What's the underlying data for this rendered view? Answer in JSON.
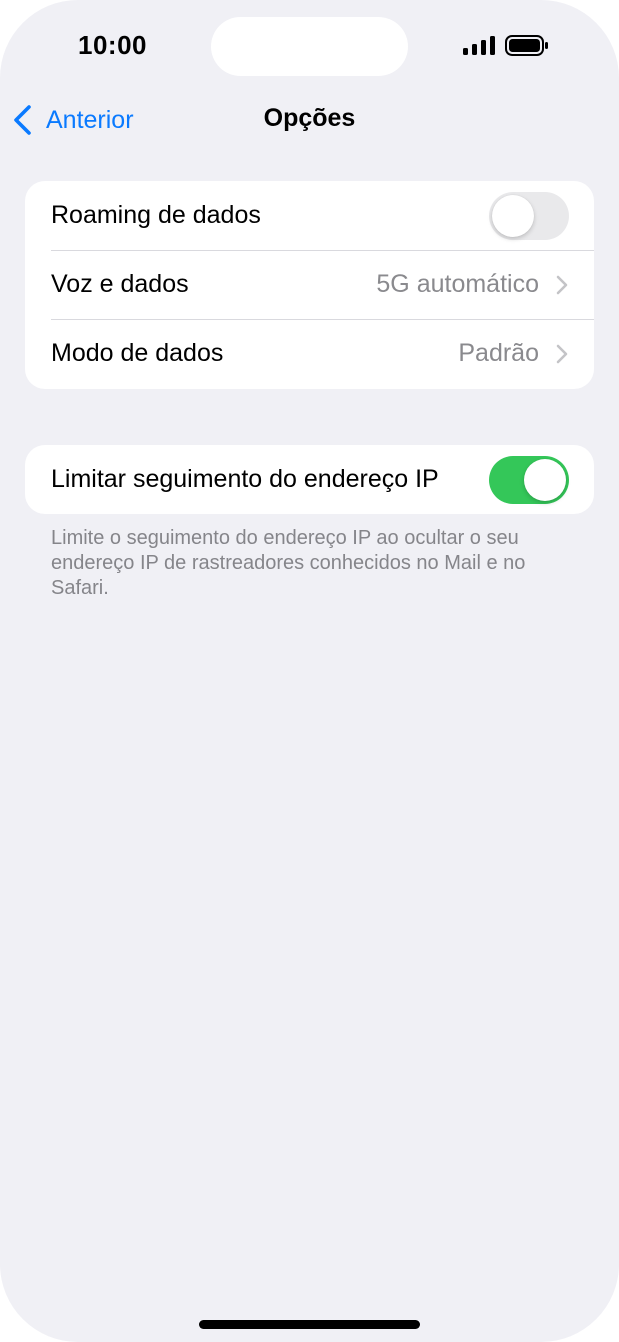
{
  "status_bar": {
    "time": "10:00",
    "signal_icon": "cellular-signal-icon",
    "battery_icon": "battery-icon"
  },
  "nav": {
    "back_label": "Anterior",
    "back_icon": "chevron-left-icon",
    "title": "Opções"
  },
  "group1": {
    "rows": [
      {
        "label": "Roaming de dados",
        "toggle": "off"
      },
      {
        "label": "Voz e dados",
        "value": "5G automático"
      },
      {
        "label": "Modo de dados",
        "value": "Padrão"
      }
    ]
  },
  "group2": {
    "rows": [
      {
        "label": "Limitar seguimento do endereço IP",
        "toggle": "on"
      }
    ],
    "footer": "Limite o seguimento do endereço IP ao ocultar o seu endereço IP de rastreadores conhecidos no Mail e no Safari."
  },
  "colors": {
    "accent": "#0a7aff",
    "toggle_on": "#34c759",
    "toggle_off": "#e9e9eb",
    "background": "#f0f0f5"
  }
}
